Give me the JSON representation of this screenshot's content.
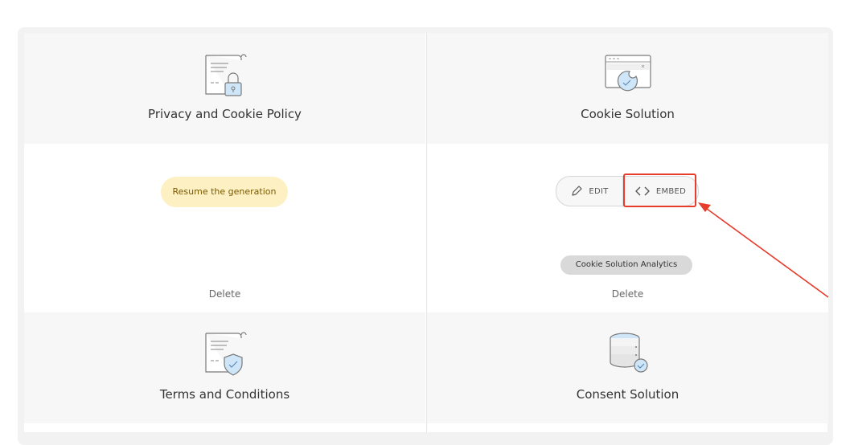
{
  "cards": {
    "privacy": {
      "title": "Privacy and Cookie Policy",
      "action_label": "Resume the generation",
      "delete_label": "Delete"
    },
    "cookie": {
      "title": "Cookie Solution",
      "edit_label": "EDIT",
      "embed_label": "EMBED",
      "analytics_label": "Cookie Solution Analytics",
      "delete_label": "Delete"
    },
    "terms": {
      "title": "Terms and Conditions"
    },
    "consent": {
      "title": "Consent Solution"
    }
  },
  "colors": {
    "accent": "#e53c2b",
    "resume_bg": "#fdf0c2",
    "icon_blue": "#cfe6f8"
  }
}
